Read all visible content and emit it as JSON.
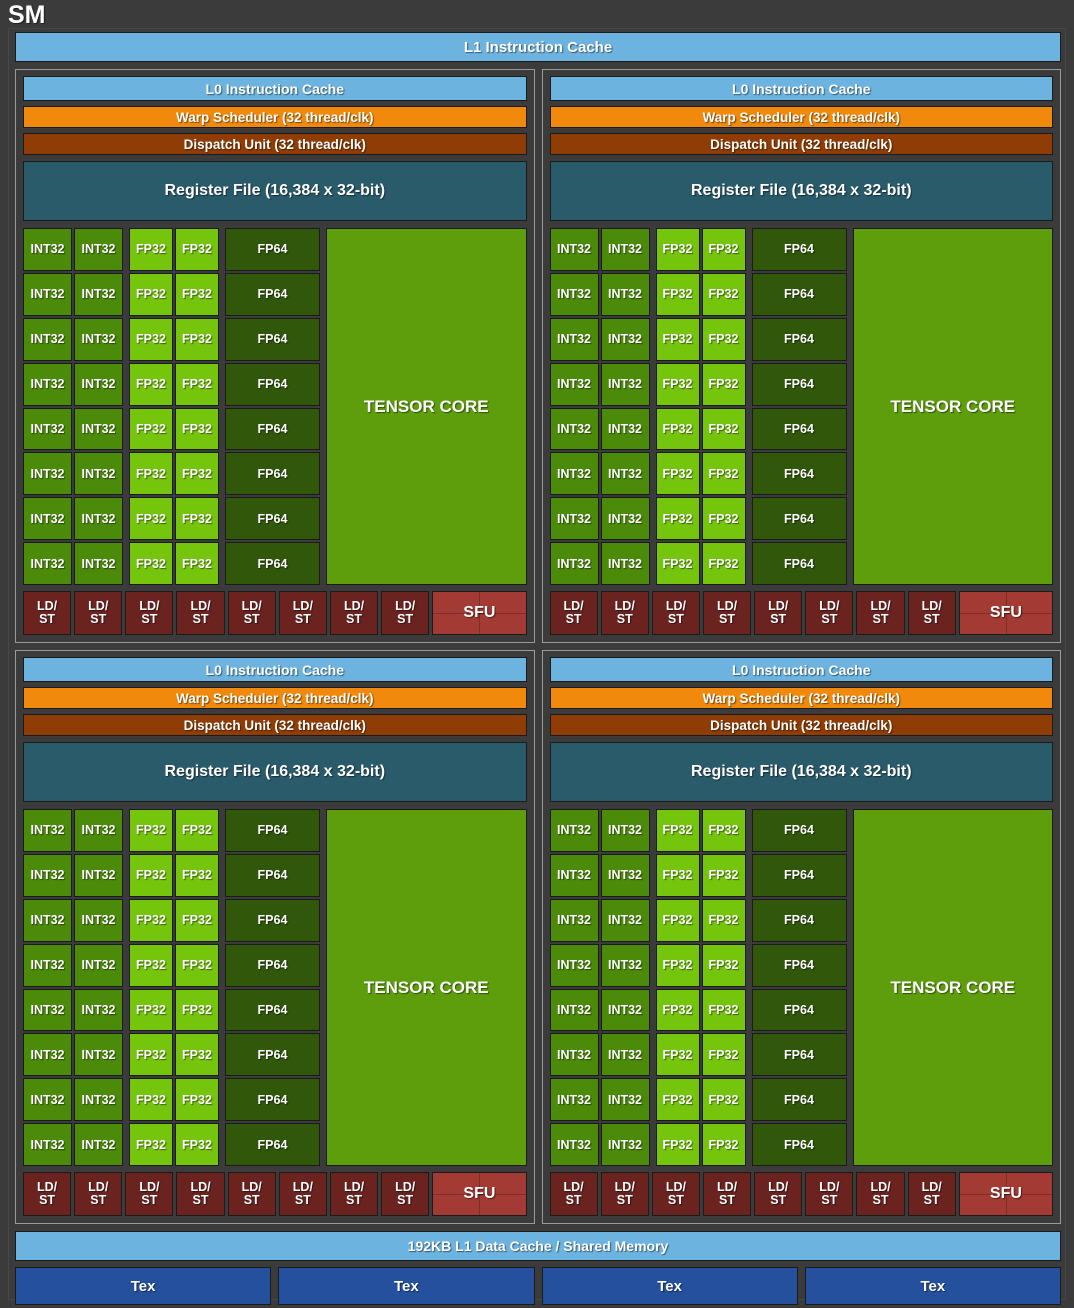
{
  "title": "SM",
  "l1_instruction_cache": "L1 Instruction Cache",
  "l1_data_cache": "192KB L1 Data Cache / Shared Memory",
  "partition": {
    "l0_instruction_cache": "L0 Instruction Cache",
    "warp_scheduler": "Warp Scheduler (32 thread/clk)",
    "dispatch_unit": "Dispatch Unit (32 thread/clk)",
    "register_file": "Register File (16,384 x 32-bit)",
    "int32": "INT32",
    "fp32": "FP32",
    "fp64": "FP64",
    "tensor_core": "TENSOR CORE",
    "ldst_top": "LD/",
    "ldst_bottom": "ST",
    "sfu": "SFU",
    "int32_per_row": 2,
    "fp32_per_row": 2,
    "fp64_per_row": 1,
    "core_rows": 8,
    "ldst_count": 8,
    "sfu_count": 1
  },
  "partition_count": 4,
  "tex_units": [
    "Tex",
    "Tex",
    "Tex",
    "Tex"
  ],
  "colors": {
    "background": "#3b3b3b",
    "instruction_cache": "#6cb3e0",
    "warp_scheduler": "#f0890c",
    "dispatch_unit": "#8f3d04",
    "register_file": "#2a5b6b",
    "int32": "#4c8a0a",
    "fp32": "#76c50d",
    "fp64": "#31570a",
    "tensor_core": "#5e9e0d",
    "ldst": "#6b2320",
    "sfu": "#a33a33",
    "tex": "#24509e",
    "partition_border": "#9a9a9a",
    "text": "#ffffff"
  }
}
